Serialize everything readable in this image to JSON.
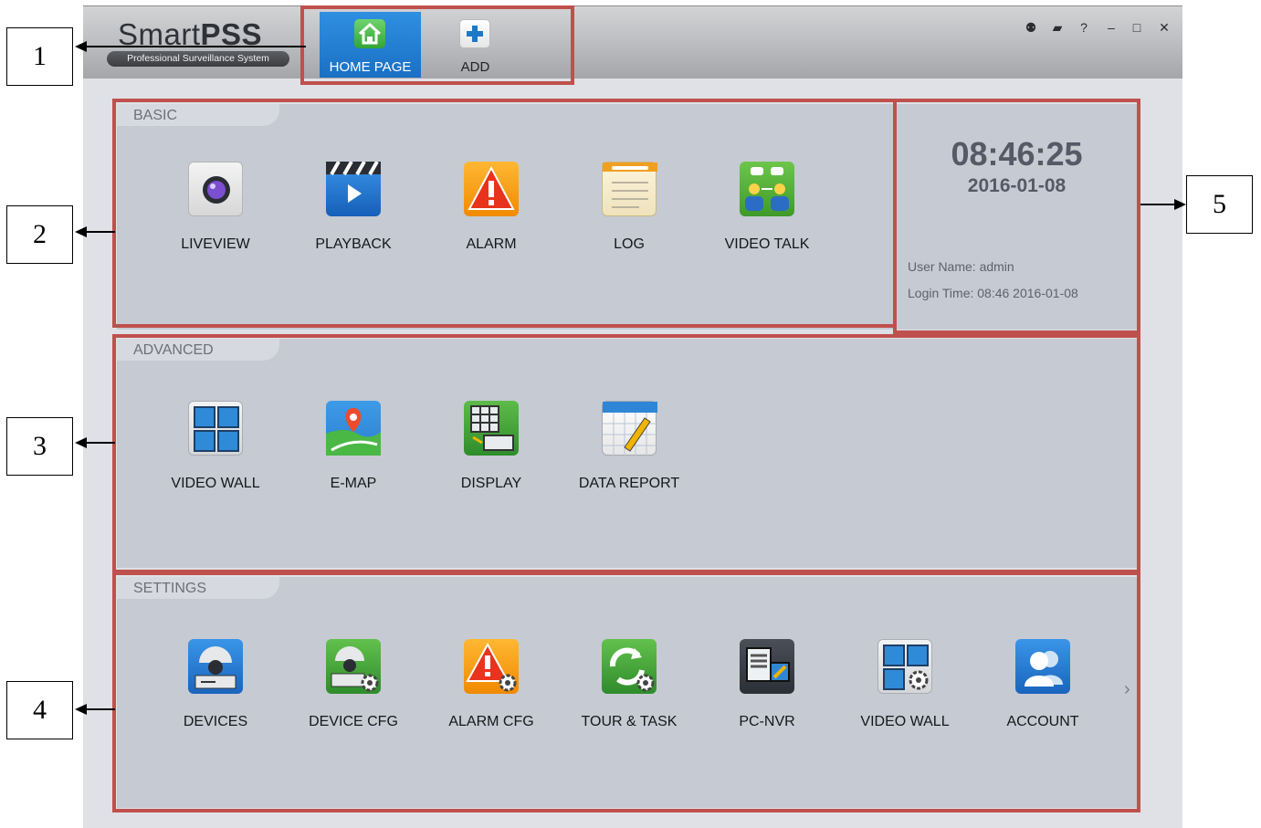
{
  "app": {
    "logo_main": "Smart",
    "logo_bold": "PSS",
    "logo_subtitle": "Professional Surveillance System"
  },
  "tabs": [
    {
      "label": "HOME PAGE",
      "icon": "home-icon",
      "active": true
    },
    {
      "label": "ADD",
      "icon": "plus-icon",
      "active": false
    }
  ],
  "window_controls": [
    "user-icon",
    "lock-icon",
    "help-icon",
    "minimize-icon",
    "maximize-icon",
    "close-icon"
  ],
  "window_control_glyphs": [
    "⚉",
    "▰",
    "?",
    "–",
    "□",
    "✕"
  ],
  "basic": {
    "title": "BASIC",
    "items": [
      {
        "label": "LIVEVIEW",
        "icon": "camera-icon"
      },
      {
        "label": "PLAYBACK",
        "icon": "clapperboard-icon"
      },
      {
        "label": "ALARM",
        "icon": "warning-icon"
      },
      {
        "label": "LOG",
        "icon": "notepad-icon"
      },
      {
        "label": "VIDEO TALK",
        "icon": "video-talk-icon"
      }
    ]
  },
  "advanced": {
    "title": "ADVANCED",
    "items": [
      {
        "label": "VIDEO WALL",
        "icon": "video-wall-icon"
      },
      {
        "label": "E-MAP",
        "icon": "map-pin-icon"
      },
      {
        "label": "DISPLAY",
        "icon": "display-icon"
      },
      {
        "label": "DATA REPORT",
        "icon": "calendar-report-icon"
      }
    ]
  },
  "settings": {
    "title": "SETTINGS",
    "items": [
      {
        "label": "DEVICES",
        "icon": "dome-camera-icon"
      },
      {
        "label": "DEVICE CFG",
        "icon": "dome-camera-gear-icon"
      },
      {
        "label": "ALARM CFG",
        "icon": "warning-gear-icon"
      },
      {
        "label": "TOUR & TASK",
        "icon": "refresh-gear-icon"
      },
      {
        "label": "PC-NVR",
        "icon": "pc-nvr-icon"
      },
      {
        "label": "VIDEO WALL",
        "icon": "video-wall-gear-icon"
      },
      {
        "label": "ACCOUNT",
        "icon": "users-icon"
      }
    ],
    "more_glyph": "›"
  },
  "status": {
    "time": "08:46:25",
    "date": "2016-01-08",
    "user_name": "User Name:  admin",
    "login_time": "Login Time:  08:46 2016-01-08"
  },
  "annotations": [
    "1",
    "2",
    "3",
    "4",
    "5"
  ],
  "colors": {
    "highlight": "#c0504d",
    "tab_active": "#1f78cc",
    "panel": "#c6cad3"
  }
}
